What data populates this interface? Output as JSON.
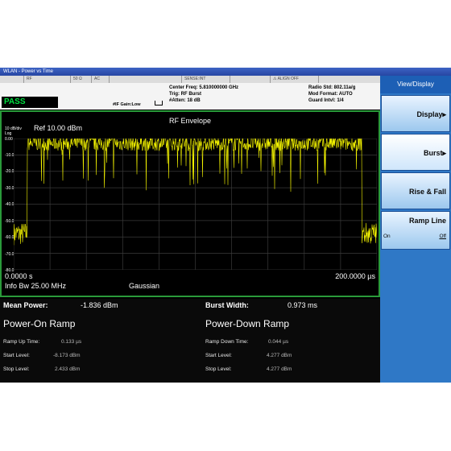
{
  "window": {
    "title": "WLAN - Power vs Time"
  },
  "status_bar": {
    "cells": [
      "",
      "RF",
      "50 Ω",
      "AC",
      "",
      "SENSE:INT",
      "",
      "⚠ ALIGN OFF"
    ]
  },
  "info_bar": {
    "pass": "PASS",
    "gain": "#IF Gain:Low",
    "center_freq": "Center Freq: 5.810000000 GHz",
    "trig": "Trig: RF Burst",
    "atten": "#Atten: 18 dB",
    "radio_std": "Radio Std: 802.11a/g",
    "mod_format": "Mod Format: AUTO",
    "guard": "Guard Intvl: 1/4"
  },
  "plot": {
    "title": "RF Envelope",
    "ref": "Ref  10.00 dBm",
    "scale_top": "10 dB/div",
    "scale_bottom": "Log",
    "yticks": [
      "0.00",
      "-10.0",
      "-20.0",
      "-30.0",
      "-40.0",
      "-50.0",
      "-60.0",
      "-70.0",
      "-80.0"
    ],
    "x_start": "0.0000 s",
    "x_stop": "200.0000 µs",
    "info_bw": "Info Bw 25.00 MHz",
    "filter": "Gaussian",
    "trace_color": "#f2f200",
    "grid_color": "#3a3a3a"
  },
  "results": {
    "mean_power_label": "Mean Power:",
    "mean_power_value": "-1.836 dBm",
    "burst_width_label": "Burst Width:",
    "burst_width_value": "0.973 ms",
    "power_on": {
      "heading": "Power-On Ramp",
      "ramp_label": "Ramp Up Time:",
      "ramp_value": "0.133 µs",
      "start_label": "Start Level:",
      "start_value": "-8.173 dBm",
      "stop_label": "Stop Level:",
      "stop_value": "2.433 dBm"
    },
    "power_down": {
      "heading": "Power-Down Ramp",
      "ramp_label": "Ramp Down Time:",
      "ramp_value": "0.044 µs",
      "start_label": "Start Level:",
      "start_value": "4.277 dBm",
      "stop_label": "Stop Level:",
      "stop_value": "4.277 dBm"
    }
  },
  "softkeys": {
    "title": "View/Display",
    "display": "Display▸",
    "burst": "Burst▸",
    "rise_fall": "Rise & Fall",
    "ramp_line": "Ramp  Line",
    "ramp_on": "On",
    "ramp_off": "Off"
  }
}
